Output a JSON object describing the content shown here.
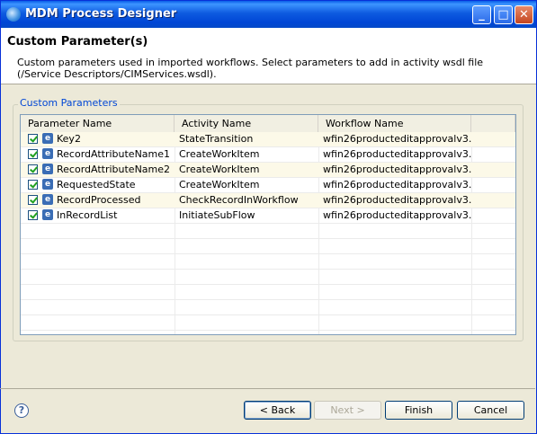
{
  "window": {
    "title": "MDM Process Designer"
  },
  "header": {
    "title": "Custom Parameter(s)",
    "description": "Custom parameters used in imported workflows. Select parameters to add in activity wsdl file (/Service Descriptors/CIMServices.wsdl)."
  },
  "group": {
    "label": "Custom Parameters"
  },
  "table": {
    "columns": [
      "Parameter Name",
      "Activity Name",
      "Workflow Name"
    ],
    "rows": [
      {
        "checked": true,
        "param": "Key2",
        "activity": "StateTransition",
        "workflow": "wfin26producteditapprovalv3...."
      },
      {
        "checked": true,
        "param": "RecordAttributeName1",
        "activity": "CreateWorkItem",
        "workflow": "wfin26producteditapprovalv3...."
      },
      {
        "checked": true,
        "param": "RecordAttributeName2",
        "activity": "CreateWorkItem",
        "workflow": "wfin26producteditapprovalv3...."
      },
      {
        "checked": true,
        "param": "RequestedState",
        "activity": "CreateWorkItem",
        "workflow": "wfin26producteditapprovalv3...."
      },
      {
        "checked": true,
        "param": "RecordProcessed",
        "activity": "CheckRecordInWorkflow",
        "workflow": "wfin26producteditapprovalv3...."
      },
      {
        "checked": true,
        "param": "InRecordList",
        "activity": "InitiateSubFlow",
        "workflow": "wfin26producteditapprovalv3...."
      }
    ]
  },
  "buttons": {
    "back": "< Back",
    "next": "Next >",
    "finish": "Finish",
    "cancel": "Cancel"
  },
  "icons": {
    "app": "designer-icon",
    "help": "help-icon",
    "param": "element-icon"
  },
  "colors": {
    "titlebar": "#0046d5",
    "accent": "#0046d5",
    "checkmark": "#21a121"
  }
}
